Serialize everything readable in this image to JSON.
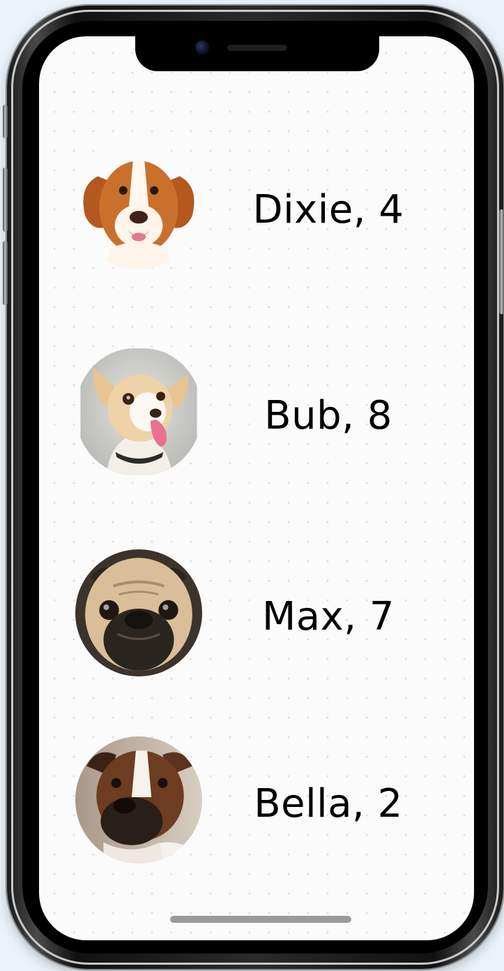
{
  "dogs": [
    {
      "name_age": "Dixie, 4",
      "avatar_icon": "dog-photo-dixie"
    },
    {
      "name_age": "Bub, 8",
      "avatar_icon": "dog-photo-bub"
    },
    {
      "name_age": "Max, 7",
      "avatar_icon": "dog-photo-max"
    },
    {
      "name_age": "Bella, 2",
      "avatar_icon": "dog-photo-bella"
    }
  ],
  "colors": {
    "screen_background": "#fbfbfc",
    "text": "#000000",
    "home_indicator": "#9a9a9a"
  }
}
